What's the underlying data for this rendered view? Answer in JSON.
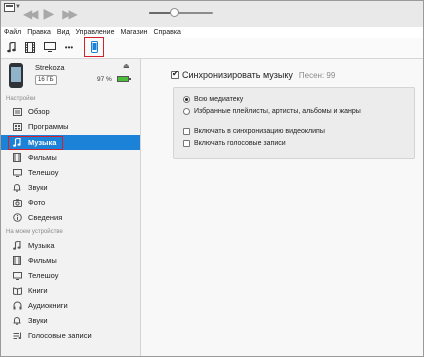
{
  "menu": [
    "Файл",
    "Правка",
    "Вид",
    "Управление",
    "Магазин",
    "Справка"
  ],
  "player": {
    "volume": 0.4
  },
  "toolbar": {
    "icons": [
      "music-note-icon",
      "film-icon",
      "tv-icon",
      "more-icon",
      "iphone-icon"
    ],
    "more_label": "•••",
    "selected": "iphone-icon"
  },
  "device": {
    "name": "Strekoza",
    "capacity": "16 ГБ",
    "battery": "97 %",
    "battery_level": 0.97
  },
  "sidebar": {
    "settings_head": "Настройки",
    "settings_items": [
      {
        "label": "Обзор",
        "icon": "overview-icon"
      },
      {
        "label": "Программы",
        "icon": "apps-icon"
      },
      {
        "label": "Музыка",
        "icon": "music-note-icon"
      },
      {
        "label": "Фильмы",
        "icon": "film-icon"
      },
      {
        "label": "Телешоу",
        "icon": "tv-icon"
      },
      {
        "label": "Звуки",
        "icon": "bell-icon"
      },
      {
        "label": "Фото",
        "icon": "camera-icon"
      },
      {
        "label": "Сведения",
        "icon": "info-icon"
      }
    ],
    "active": "Музыка",
    "ondevice_head": "На моем устройстве",
    "ondevice_items": [
      {
        "label": "Музыка",
        "icon": "music-note-icon"
      },
      {
        "label": "Фильмы",
        "icon": "film-icon"
      },
      {
        "label": "Телешоу",
        "icon": "tv-icon"
      },
      {
        "label": "Книги",
        "icon": "book-icon"
      },
      {
        "label": "Аудиокниги",
        "icon": "audiobook-icon"
      },
      {
        "label": "Звуки",
        "icon": "bell-icon"
      },
      {
        "label": "Голосовые записи",
        "icon": "voice-memo-icon"
      }
    ]
  },
  "main": {
    "sync_label": "Синхронизировать музыку",
    "sync_checked": true,
    "song_count": "Песен: 99",
    "options": {
      "entire_library": "Всю медиатеку",
      "selected_items": "Избранные плейлисты, артисты, альбомы и жанры",
      "include_videos": "Включать в синхронизацию видеоклипы",
      "include_voice": "Включать голосовые записи"
    }
  },
  "colors": {
    "accent": "#1c82d8",
    "highlight": "#d2202e"
  }
}
